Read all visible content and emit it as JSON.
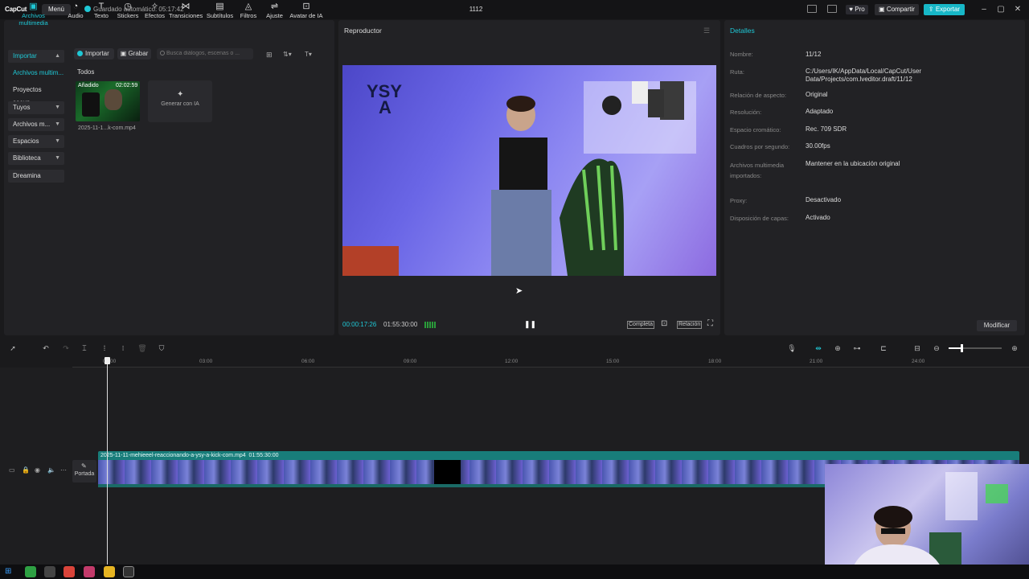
{
  "app": {
    "logo": "CapCut",
    "menu": "Menú",
    "autosave": "Guardado automático: 05:17:42",
    "project_title": "1112",
    "pro": "Pro",
    "share": "Compartir",
    "export": "Exportar"
  },
  "toolbar": {
    "tools": [
      {
        "label": "Archivos multimedia",
        "icon": "media-icon"
      },
      {
        "label": "Audio",
        "icon": "audio-icon"
      },
      {
        "label": "Texto",
        "icon": "text-icon"
      },
      {
        "label": "Stickers",
        "icon": "sticker-icon"
      },
      {
        "label": "Efectos",
        "icon": "effects-icon"
      },
      {
        "label": "Transiciones",
        "icon": "transitions-icon"
      },
      {
        "label": "Subtítulos",
        "icon": "subtitles-icon"
      },
      {
        "label": "Filtros",
        "icon": "filters-icon"
      },
      {
        "label": "Ajuste",
        "icon": "adjust-icon"
      },
      {
        "label": "Avatar de IA",
        "icon": "avatar-icon"
      }
    ]
  },
  "sidebar": {
    "items": [
      "Importar",
      "Archivos multim...",
      "Proyectos secun...",
      "Tuyos",
      "Archivos m...",
      "Espacios",
      "Biblioteca",
      "Dreamina"
    ]
  },
  "media": {
    "import": "Importar",
    "record": "Grabar",
    "search_placeholder": "Busca diálogos, escenas o ...",
    "section": "Todos",
    "item": {
      "badge": "Añadido",
      "duration": "02:02:59",
      "name": "2025-11-1...k-com.mp4"
    },
    "generate": "Generar con IA"
  },
  "player": {
    "title": "Reproductor",
    "current": "00:00:17:26",
    "total": "01:55:30:00",
    "full": "Completa",
    "ratio": "Relación"
  },
  "details": {
    "title": "Detalles",
    "rows": [
      {
        "label": "Nombre:",
        "value": "11/12"
      },
      {
        "label": "Ruta:",
        "value": "C:/Users/IK/AppData/Local/CapCut/User Data/Projects/com.lveditor.draft/11/12"
      },
      {
        "label": "Relación de aspecto:",
        "value": "Original"
      },
      {
        "label": "Resolución:",
        "value": "Adaptado"
      },
      {
        "label": "Espacio cromático:",
        "value": "Rec. 709 SDR"
      },
      {
        "label": "Cuadros por segundo:",
        "value": "30.00fps"
      },
      {
        "label": "Archivos multimedia importados:",
        "value": "Mantener en la ubicación original"
      },
      {
        "label": "Proxy:",
        "value": "Desactivado"
      },
      {
        "label": "Disposición de capas:",
        "value": "Activado"
      }
    ],
    "modify": "Modificar"
  },
  "timeline": {
    "ticks": [
      "00:00",
      "03:00",
      "06:00",
      "09:00",
      "12:00",
      "15:00",
      "18:00",
      "21:00",
      "24:00"
    ],
    "cover": "Portada",
    "clip_name": "2025-11-11-mehieeel-reaccionando-a-ysy-a-kick-com.mp4",
    "clip_duration": "01:55:30:00"
  }
}
